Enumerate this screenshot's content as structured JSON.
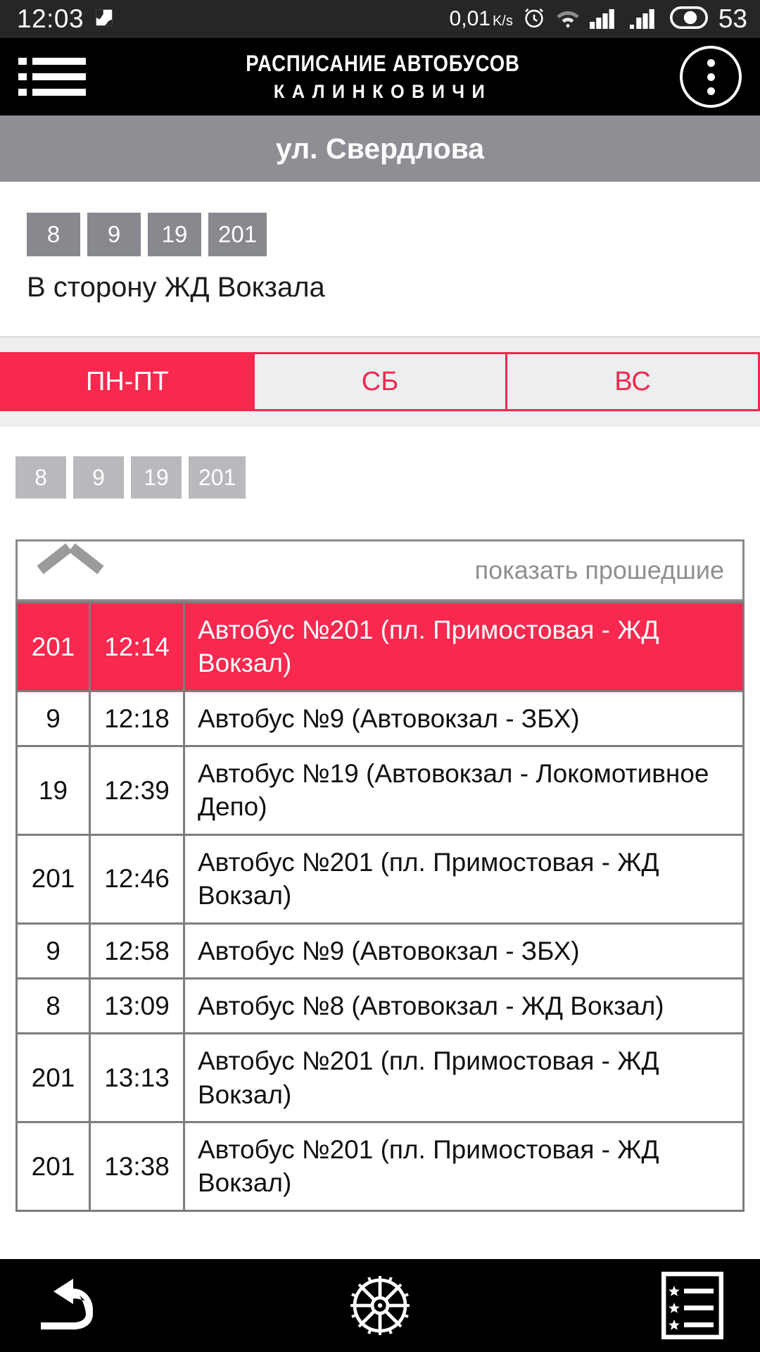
{
  "statusbar": {
    "clock": "12:03",
    "image_icon": "image-icon",
    "data_rate": "0,01",
    "data_rate_unit": "K/s",
    "alarm_icon": "alarm-clock-icon",
    "wifi_icon": "wifi-icon",
    "sim1_icon": "signal-bars-icon",
    "sim2_icon": "signal-bars-icon",
    "battery_icon": "battery-icon",
    "battery_level": "53"
  },
  "appbar": {
    "menu_icon": "list-menu-icon",
    "brand_line1": "РАСПИСАНИЕ АВТОБУСОВ",
    "brand_line2": "КАЛИНКОВИЧИ",
    "more_icon": "more-vertical-icon"
  },
  "stop": {
    "name": "ул. Свердлова"
  },
  "summary": {
    "routes": [
      "8",
      "9",
      "19",
      "201"
    ],
    "direction": "В сторону ЖД Вокзала"
  },
  "day_tabs": [
    {
      "label": "ПН-ПТ",
      "active": true
    },
    {
      "label": "СБ",
      "active": false
    },
    {
      "label": "ВС",
      "active": false
    }
  ],
  "filter_routes": [
    "8",
    "9",
    "19",
    "201"
  ],
  "past_toggle": {
    "chevron_icon": "chevron-up-icon",
    "label": "показать прошедшие"
  },
  "schedule": {
    "rows": [
      {
        "route": "201",
        "time": "12:14",
        "desc": "Автобус №201 (пл. Примостовая - ЖД Вокзал)",
        "highlighted": true
      },
      {
        "route": "9",
        "time": "12:18",
        "desc": "Автобус №9 (Автовокзал - ЗБХ)",
        "highlighted": false
      },
      {
        "route": "19",
        "time": "12:39",
        "desc": "Автобус №19 (Автовокзал - Локомотивное Депо)",
        "highlighted": false
      },
      {
        "route": "201",
        "time": "12:46",
        "desc": "Автобус №201 (пл. Примостовая - ЖД Вокзал)",
        "highlighted": false
      },
      {
        "route": "9",
        "time": "12:58",
        "desc": "Автобус №9 (Автовокзал - ЗБХ)",
        "highlighted": false
      },
      {
        "route": "8",
        "time": "13:09",
        "desc": "Автобус №8 (Автовокзал - ЖД Вокзал)",
        "highlighted": false
      },
      {
        "route": "201",
        "time": "13:13",
        "desc": "Автобус №201 (пл. Примостовая - ЖД Вокзал)",
        "highlighted": false
      },
      {
        "route": "201",
        "time": "13:38",
        "desc": "Автобус №201 (пл. Примостовая - ЖД Вокзал)",
        "highlighted": false
      }
    ]
  },
  "navbar": {
    "back_icon": "back-arrow-icon",
    "home_icon": "gear-home-icon",
    "recents_icon": "recents-list-icon"
  },
  "colors": {
    "accent": "#f9284e",
    "header_bg": "#000000",
    "stopbar_bg": "#8d8f94",
    "badge_dark": "#87898e",
    "badge_light": "#b7b9bc",
    "tabstrip_bg": "#eceef0"
  }
}
